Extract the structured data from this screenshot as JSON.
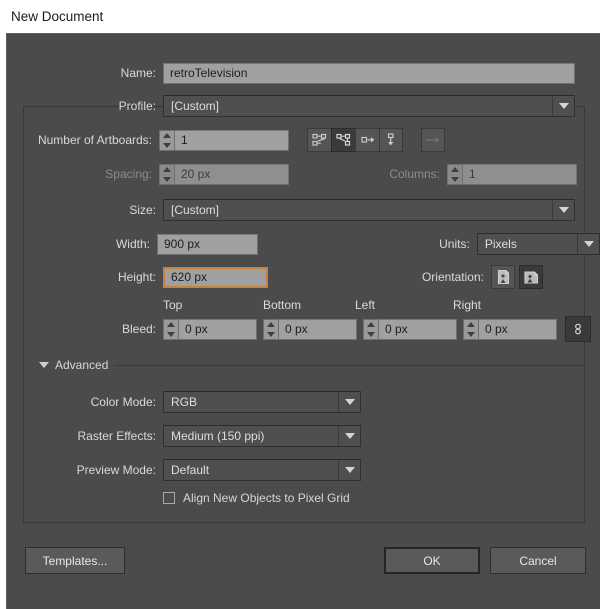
{
  "window": {
    "title": "New Document"
  },
  "fields": {
    "name": {
      "label": "Name:",
      "value": "retroTelevision"
    },
    "profile": {
      "label": "Profile:",
      "value": "[Custom]"
    },
    "artboards": {
      "label": "Number of Artboards:",
      "value": "1"
    },
    "spacing": {
      "label": "Spacing:",
      "value": "20 px"
    },
    "columns": {
      "label": "Columns:",
      "value": "1"
    },
    "size": {
      "label": "Size:",
      "value": "[Custom]"
    },
    "width": {
      "label": "Width:",
      "value": "900 px"
    },
    "height": {
      "label": "Height:",
      "value": "620 px"
    },
    "units": {
      "label": "Units:",
      "value": "Pixels"
    },
    "orientation": {
      "label": "Orientation:"
    },
    "bleed": {
      "label": "Bleed:",
      "columns": [
        "Top",
        "Bottom",
        "Left",
        "Right"
      ],
      "values": [
        "0 px",
        "0 px",
        "0 px",
        "0 px"
      ]
    }
  },
  "advanced": {
    "title": "Advanced",
    "color_mode": {
      "label": "Color Mode:",
      "value": "RGB"
    },
    "raster_effects": {
      "label": "Raster Effects:",
      "value": "Medium (150 ppi)"
    },
    "preview_mode": {
      "label": "Preview Mode:",
      "value": "Default"
    },
    "align_pixel_grid": {
      "label": "Align New Objects to Pixel Grid",
      "checked": false
    }
  },
  "footer": {
    "templates": "Templates...",
    "ok": "OK",
    "cancel": "Cancel"
  },
  "colors": {
    "dialog_bg": "#4b4b4b",
    "titlebar_bg": "#ffffff",
    "input_bg": "#a0a0a0",
    "dropdown_bg": "#4f4f4f",
    "focus_ring": "#c8803a",
    "text": "#d9d9d9",
    "disabled_text": "#8c8c8c"
  }
}
